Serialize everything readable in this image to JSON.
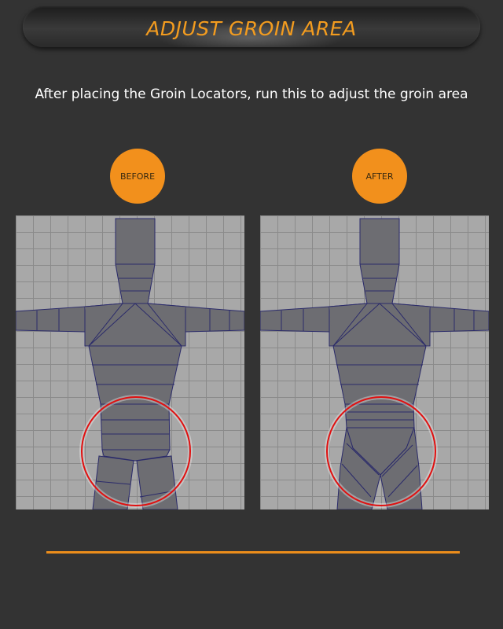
{
  "header": {
    "title": "ADJUST GROIN AREA"
  },
  "intro": {
    "text": "After placing the Groin Locators, run this to adjust the groin area"
  },
  "panels": [
    {
      "badge": "BEFORE"
    },
    {
      "badge": "AFTER"
    }
  ],
  "colors": {
    "accent": "#f2901c",
    "background": "#333333",
    "mesh_fill": "#6d6d72",
    "mesh_edge": "#2a2a6a",
    "highlight_circle": "#e01010"
  }
}
